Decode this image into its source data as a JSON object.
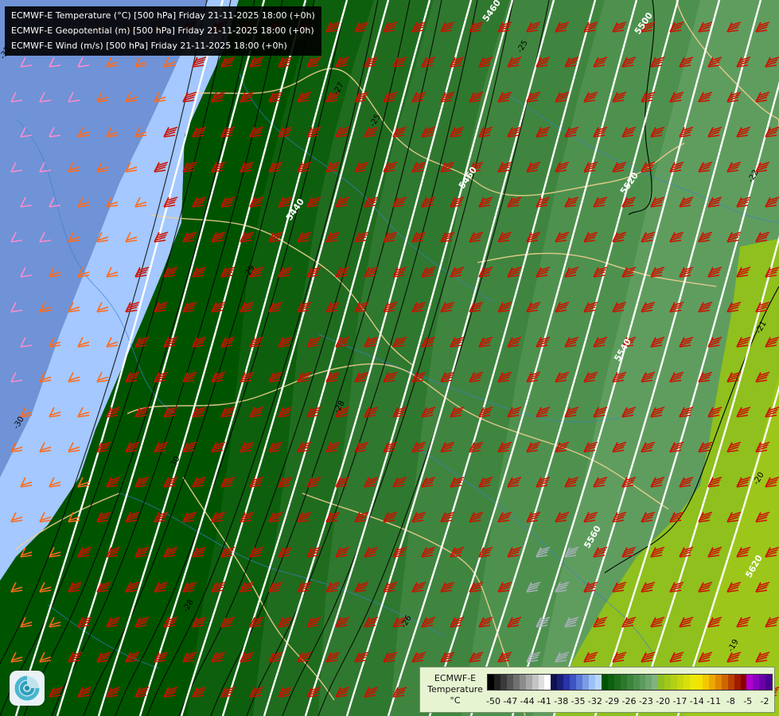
{
  "title": {
    "lines": [
      "ECMWF-E Temperature (°C) [500 hPa] Friday 21-11-2025 18:00 (+0h)",
      "ECMWF-E Geopotential (m) [500 hPa] Friday 21-11-2025 18:00 (+0h)",
      "ECMWF-E Wind (m/s) [500 hPa] Friday 21-11-2025 18:00 (+0h)"
    ]
  },
  "map": {
    "geopotential_labels": [
      "5460",
      "5500",
      "5440",
      "5520",
      "5540",
      "5560",
      "5620"
    ],
    "temperature_labels": [
      "-32",
      "-30",
      "-29",
      "-28",
      "-27",
      "-26",
      "-25",
      "-24",
      "-23",
      "-22",
      "-21",
      "-20",
      "-19"
    ],
    "fill_colors": [
      "#6f93d6",
      "#a4c8ff",
      "#8db6f2",
      "#005400",
      "#0d5f0d",
      "#1f6c1f",
      "#2f782f",
      "#3f853f",
      "#4e914e",
      "#5f9d5f",
      "#8fc01e",
      "#9cc71a"
    ],
    "wind_barb_colors": [
      "#ff8ccf",
      "#ff6a1a",
      "#cc1100",
      "#a7b0b9"
    ],
    "contour_colors": {
      "geopotential": "#ffffff",
      "temperature": "#000000",
      "borders": "#f0d090",
      "rivers": "#3b7fcf"
    }
  },
  "legend": {
    "title": [
      "ECMWF-E",
      "Temperature",
      "°C"
    ],
    "ticks": [
      "-50",
      "-47",
      "-44",
      "-41",
      "-38",
      "-35",
      "-32",
      "-29",
      "-26",
      "-23",
      "-20",
      "-17",
      "-14",
      "-11",
      "-8",
      "-5",
      "-2"
    ],
    "colors": [
      "#000000",
      "#202020",
      "#3a3a3a",
      "#555555",
      "#707070",
      "#8c8c8c",
      "#a8a8a8",
      "#c4c4c4",
      "#e0e0e0",
      "#ffffff",
      "#101050",
      "#18207a",
      "#2a33a8",
      "#3d54c2",
      "#5a79d6",
      "#7a9de6",
      "#9ec1f5",
      "#b8d6fb",
      "#005400",
      "#0d600d",
      "#1d6b1d",
      "#2c772c",
      "#3c833c",
      "#4c8f4c",
      "#5c9b5c",
      "#6ea76e",
      "#80b380",
      "#8fc01e",
      "#a0c818",
      "#b3d014",
      "#c6d810",
      "#d8e00c",
      "#eae808",
      "#f4e400",
      "#f4c800",
      "#eca800",
      "#e08800",
      "#cf6600",
      "#b84000",
      "#a01a00",
      "#8a0000",
      "#b000d0",
      "#8a00c0",
      "#6a00a8",
      "#4a0090"
    ]
  }
}
